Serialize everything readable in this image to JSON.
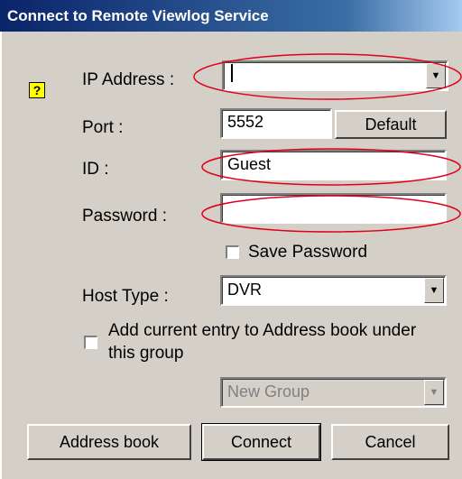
{
  "window": {
    "title": "Connect to Remote Viewlog Service"
  },
  "form": {
    "ip_label": "IP Address :",
    "ip_value": "",
    "port_label": "Port :",
    "port_value": "5552",
    "default_button": "Default",
    "id_label": "ID :",
    "id_value": "Guest",
    "password_label": "Password :",
    "password_value": "",
    "save_password_label": "Save Password",
    "save_password_checked": false,
    "host_type_label": "Host Type :",
    "host_type_value": "DVR",
    "add_entry_label_line1": "Add current entry to Address book under",
    "add_entry_label_line2": "this group",
    "add_entry_checked": false,
    "group_value": "New Group"
  },
  "buttons": {
    "address_book": "Address book",
    "connect": "Connect",
    "cancel": "Cancel"
  },
  "icons": {
    "help": "?",
    "dropdown": "▼"
  },
  "annotation_color": "#e0001a"
}
